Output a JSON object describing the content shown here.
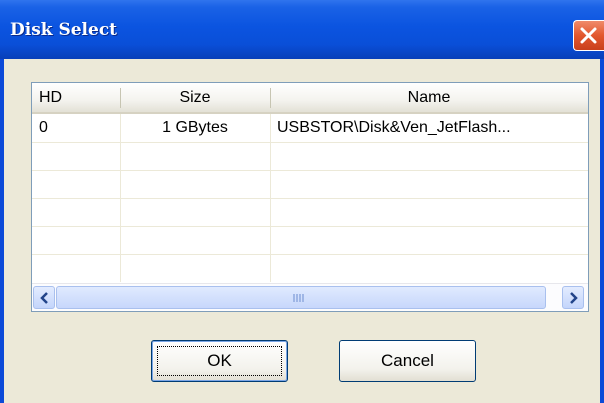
{
  "window": {
    "title": "Disk Select"
  },
  "table": {
    "columns": [
      "HD",
      "Size",
      "Name"
    ],
    "rows": [
      [
        "0",
        "1 GBytes",
        "USBSTOR\\Disk&Ven_JetFlash..."
      ]
    ]
  },
  "buttons": {
    "ok": "OK",
    "cancel": "Cancel"
  },
  "colors": {
    "titlebar": "#0a4fd8",
    "close": "#e2572e",
    "dialog_bg": "#ece9d8",
    "list_border": "#7f9db9"
  },
  "icons": {
    "close": "close-icon",
    "scroll_left": "arrow-left-icon",
    "scroll_right": "arrow-right-icon",
    "grip": "scroll-grip-icon"
  }
}
